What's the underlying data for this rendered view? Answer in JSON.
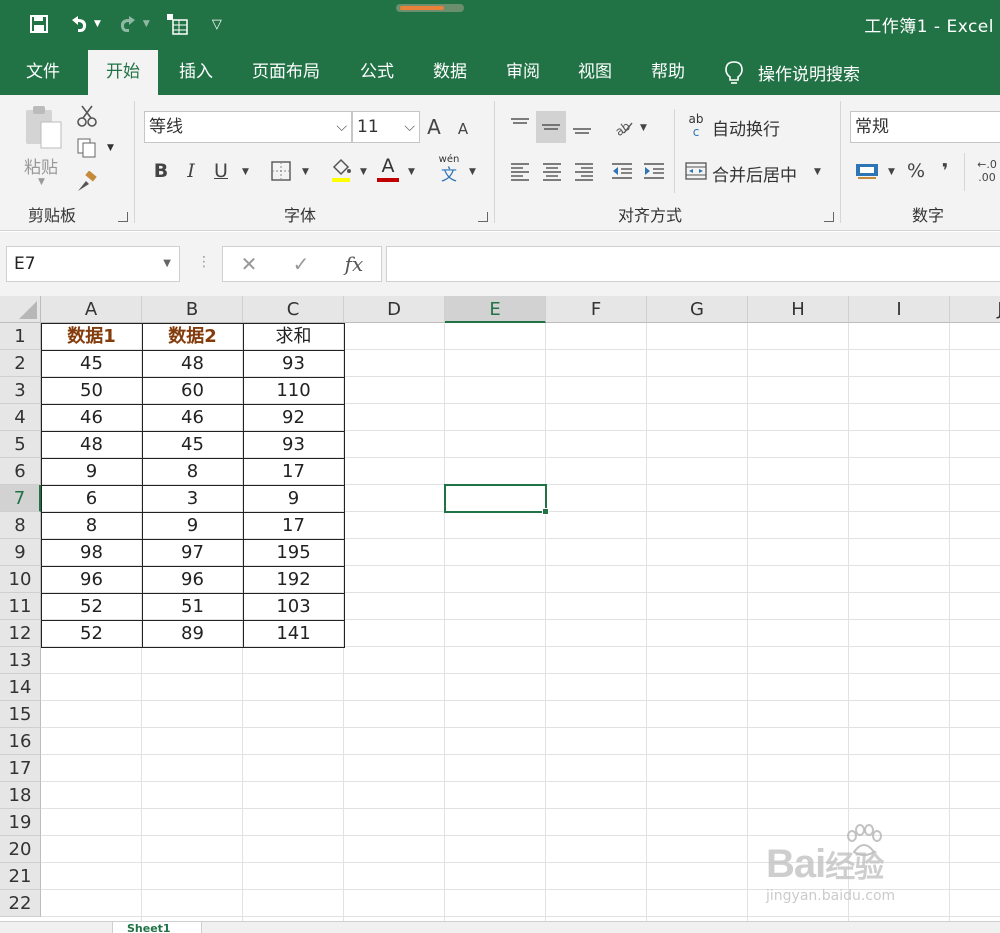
{
  "window": {
    "title": "工作簿1  -  Excel"
  },
  "ribbon_tabs": [
    {
      "label": "文件"
    },
    {
      "label": "开始"
    },
    {
      "label": "插入"
    },
    {
      "label": "页面布局"
    },
    {
      "label": "公式"
    },
    {
      "label": "数据"
    },
    {
      "label": "审阅"
    },
    {
      "label": "视图"
    },
    {
      "label": "帮助"
    }
  ],
  "tell_me": "操作说明搜索",
  "clipboard": {
    "paste_label": "粘贴",
    "group_label": "剪贴板"
  },
  "font": {
    "name": "等线",
    "size": "11",
    "bold": "B",
    "italic": "I",
    "underline": "U",
    "font_color_glyph": "A",
    "phonetic_top": "wén",
    "phonetic_bottom": "文",
    "grow": "A",
    "shrink": "A",
    "group_label": "字体"
  },
  "alignment": {
    "wrap_text_label": "自动换行",
    "wrap_icon_top": "ab",
    "wrap_icon_bottom": "c",
    "merge_label": "合并后居中",
    "group_label": "对齐方式"
  },
  "number": {
    "format": "常规",
    "percent": "%",
    "comma": "❜",
    "decimal_top": "←.0",
    "decimal_bottom": ".00",
    "group_label": "数字"
  },
  "formula_bar": {
    "name_box": "E7",
    "fx": "fx",
    "formula": ""
  },
  "columns": [
    "A",
    "B",
    "C",
    "D",
    "E",
    "F",
    "G",
    "H",
    "I",
    "J"
  ],
  "rows": [
    "1",
    "2",
    "3",
    "4",
    "5",
    "6",
    "7",
    "8",
    "9",
    "10",
    "11",
    "12",
    "13",
    "14",
    "15",
    "16",
    "17",
    "18",
    "19",
    "20",
    "21",
    "22"
  ],
  "sheet": {
    "headers": [
      "数据1",
      "数据2",
      "求和"
    ],
    "data": [
      [
        "45",
        "48",
        "93"
      ],
      [
        "50",
        "60",
        "110"
      ],
      [
        "46",
        "46",
        "92"
      ],
      [
        "48",
        "45",
        "93"
      ],
      [
        "9",
        "8",
        "17"
      ],
      [
        "6",
        "3",
        "9"
      ],
      [
        "8",
        "9",
        "17"
      ],
      [
        "98",
        "97",
        "195"
      ],
      [
        "96",
        "96",
        "192"
      ],
      [
        "52",
        "51",
        "103"
      ],
      [
        "52",
        "89",
        "141"
      ]
    ]
  },
  "selected_cell": "E7",
  "sheet_tab": "Sheet1",
  "watermark": {
    "brand": "Bai",
    "brand2": "经验",
    "url": "jingyan.baidu.com"
  },
  "colors": {
    "excel_green": "#217346",
    "header_text": "#843c0c"
  }
}
